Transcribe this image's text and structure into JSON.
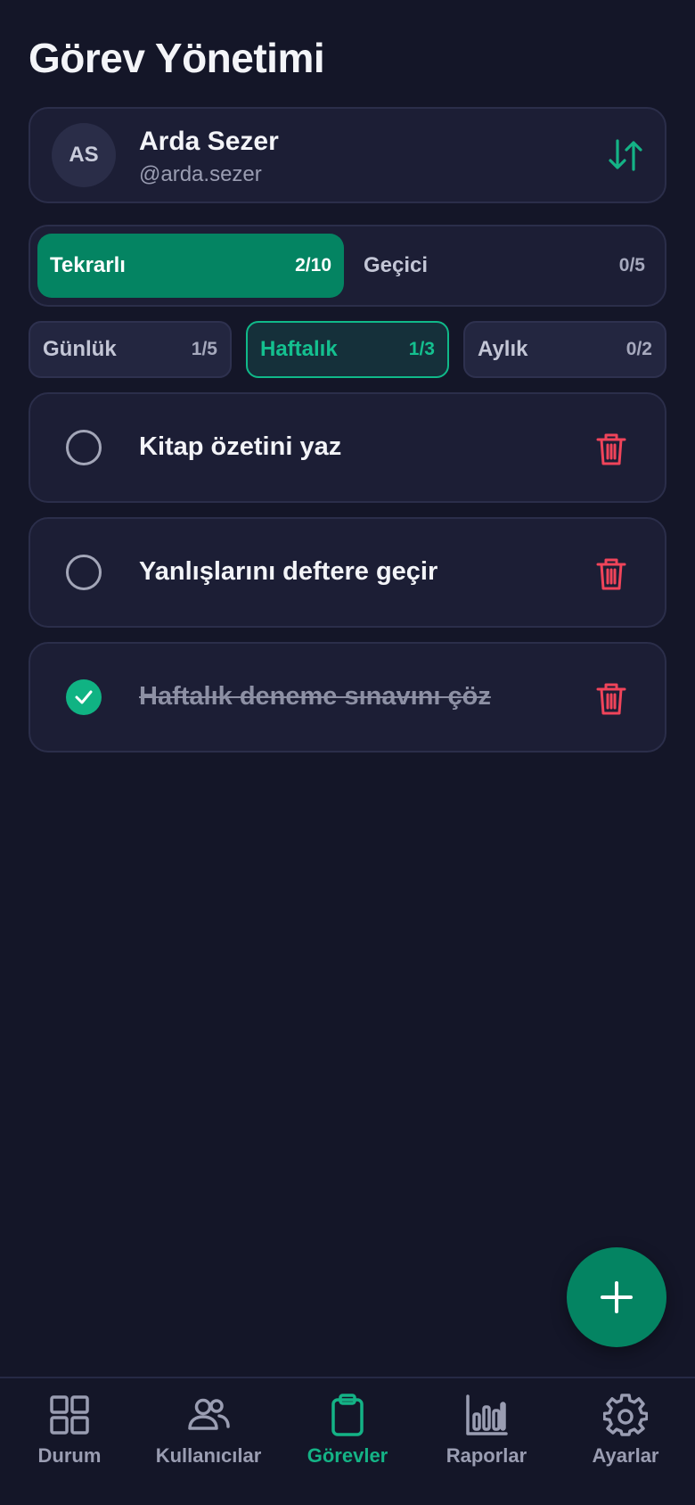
{
  "header": {
    "title": "Görev Yönetimi"
  },
  "user": {
    "initials": "AS",
    "name": "Arda Sezer",
    "handle": "@arda.sezer"
  },
  "type_tabs": [
    {
      "label": "Tekrarlı",
      "count": "2/10",
      "active": true
    },
    {
      "label": "Geçici",
      "count": "0/5",
      "active": false
    }
  ],
  "period_tabs": [
    {
      "label": "Günlük",
      "count": "1/5",
      "active": false
    },
    {
      "label": "Haftalık",
      "count": "1/3",
      "active": true
    },
    {
      "label": "Aylık",
      "count": "0/2",
      "active": false
    }
  ],
  "tasks": [
    {
      "text": "Kitap özetini yaz",
      "done": false
    },
    {
      "text": "Yanlışlarını deftere geçir",
      "done": false
    },
    {
      "text": "Haftalık deneme sınavını çöz",
      "done": true
    }
  ],
  "nav": [
    {
      "label": "Durum",
      "icon": "grid-icon",
      "active": false
    },
    {
      "label": "Kullanıcılar",
      "icon": "users-icon",
      "active": false
    },
    {
      "label": "Görevler",
      "icon": "clipboard-icon",
      "active": true
    },
    {
      "label": "Raporlar",
      "icon": "bar-chart-icon",
      "active": false
    },
    {
      "label": "Ayarlar",
      "icon": "gear-icon",
      "active": false
    }
  ],
  "colors": {
    "background": "#141628",
    "card": "#1c1e35",
    "accent": "#048462",
    "accent_text": "#14c08f",
    "danger": "#f0445a",
    "muted": "#9a9db2"
  }
}
